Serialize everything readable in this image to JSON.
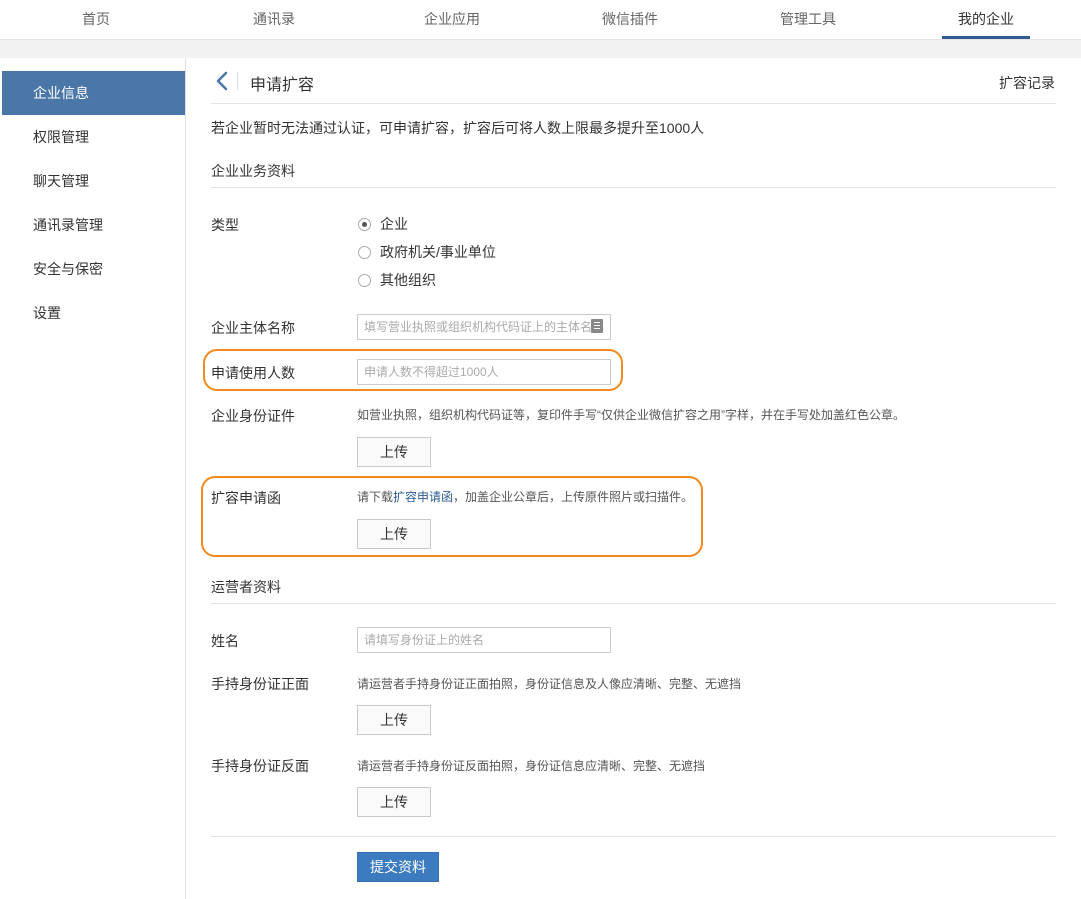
{
  "topnav": {
    "tabs": [
      {
        "label": "首页",
        "active": false
      },
      {
        "label": "通讯录",
        "active": false
      },
      {
        "label": "企业应用",
        "active": false
      },
      {
        "label": "微信插件",
        "active": false
      },
      {
        "label": "管理工具",
        "active": false
      },
      {
        "label": "我的企业",
        "active": true
      }
    ]
  },
  "sidebar": {
    "items": [
      {
        "label": "企业信息",
        "active": true
      },
      {
        "label": "权限管理",
        "active": false
      },
      {
        "label": "聊天管理",
        "active": false
      },
      {
        "label": "通讯录管理",
        "active": false
      },
      {
        "label": "安全与保密",
        "active": false
      },
      {
        "label": "设置",
        "active": false
      }
    ]
  },
  "header": {
    "title": "申请扩容",
    "record_link": "扩容记录",
    "back_icon": "chevron-left-icon"
  },
  "description": "若企业暂时无法通过认证，可申请扩容，扩容后可将人数上限最多提升至1000人",
  "business_section": {
    "title": "企业业务资料",
    "type": {
      "label": "类型",
      "options": [
        "企业",
        "政府机关/事业单位",
        "其他组织"
      ],
      "selected": "企业"
    },
    "entity_name": {
      "label": "企业主体名称",
      "placeholder": "填写营业执照或组织机构代码证上的主体名称",
      "value": ""
    },
    "headcount": {
      "label": "申请使用人数",
      "placeholder": "申请人数不得超过1000人",
      "value": ""
    },
    "id_document": {
      "label": "企业身份证件",
      "hint": "如营业执照，组织机构代码证等，复印件手写“仅供企业微信扩容之用”字样，并在手写处加盖红色公章。",
      "button": "上传"
    },
    "expansion_letter": {
      "label": "扩容申请函",
      "hint_prefix": "请下载",
      "hint_link": "扩容申请函",
      "hint_suffix": "，加盖企业公章后，上传原件照片或扫描件。",
      "button": "上传"
    }
  },
  "operator_section": {
    "title": "运营者资料",
    "name": {
      "label": "姓名",
      "placeholder": "请填写身份证上的姓名",
      "value": ""
    },
    "id_front": {
      "label": "手持身份证正面",
      "hint": "请运营者手持身份证正面拍照，身份证信息及人像应清晰、完整、无遮挡",
      "button": "上传"
    },
    "id_back": {
      "label": "手持身份证反面",
      "hint": "请运营者手持身份证反面拍照，身份证信息应清晰、完整、无遮挡",
      "button": "上传"
    }
  },
  "submit_label": "提交资料",
  "colors": {
    "accent": "#3d7bc1",
    "sidebar_active": "#4a76a8",
    "highlight": "#f08a1c",
    "link": "#2e5b92"
  }
}
